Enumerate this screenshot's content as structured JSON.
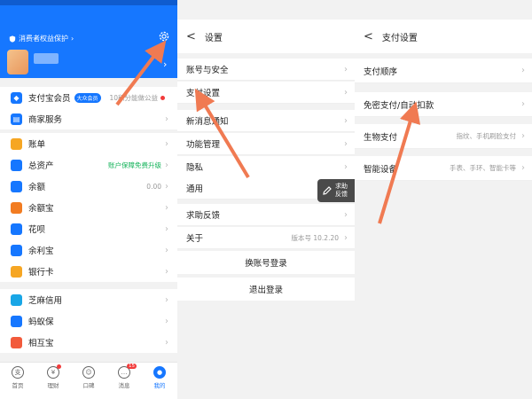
{
  "panel1": {
    "protect_label": "消费者权益保护",
    "member": {
      "label": "支付宝会员",
      "badge": "大众会员",
      "right_text": "10积分能做公益"
    },
    "merchant": {
      "label": "商家服务"
    },
    "menu": [
      {
        "label": "账单",
        "icon": "bill-icon",
        "color": "#f6a623",
        "right": ""
      },
      {
        "label": "总资产",
        "icon": "pie-icon",
        "color": "#1677ff",
        "right": "账户保障免费升级",
        "right_green": true
      },
      {
        "label": "余额",
        "icon": "yen-icon",
        "color": "#1677ff",
        "right": "0.00"
      },
      {
        "label": "余额宝",
        "icon": "yuebao-icon",
        "color": "#f27c21",
        "right": ""
      },
      {
        "label": "花呗",
        "icon": "huabei-icon",
        "color": "#1677ff",
        "right": ""
      },
      {
        "label": "余利宝",
        "icon": "yulibao-icon",
        "color": "#1677ff",
        "right": ""
      },
      {
        "label": "银行卡",
        "icon": "card-icon",
        "color": "#f6a623",
        "right": ""
      },
      {
        "label": "芝麻信用",
        "icon": "sesame-icon",
        "color": "#19a6e6",
        "right": ""
      },
      {
        "label": "蚂蚁保",
        "icon": "antbao-icon",
        "color": "#1677ff",
        "right": ""
      },
      {
        "label": "相互宝",
        "icon": "heart-icon",
        "color": "#f25a3b",
        "right": ""
      }
    ],
    "tabs": [
      {
        "label": "首页",
        "icon": "home-icon"
      },
      {
        "label": "理财",
        "icon": "wealth-icon"
      },
      {
        "label": "口碑",
        "icon": "koubei-icon"
      },
      {
        "label": "消息",
        "icon": "message-icon",
        "count": "15"
      },
      {
        "label": "我的",
        "icon": "user-icon"
      }
    ]
  },
  "panel2": {
    "title": "设置",
    "back": "<",
    "items": [
      {
        "label": "账号与安全",
        "value": ""
      },
      {
        "label": "支付设置",
        "value": ""
      },
      {
        "label": "新消息通知",
        "value": ""
      },
      {
        "label": "功能管理",
        "value": ""
      },
      {
        "label": "隐私",
        "value": ""
      },
      {
        "label": "通用",
        "value": ""
      },
      {
        "label": "求助反馈",
        "value": ""
      },
      {
        "label": "关于",
        "value": "版本号 10.2.20"
      }
    ],
    "switch_account": "换账号登录",
    "logout": "退出登录",
    "float_help": {
      "line1": "求助",
      "line2": "反馈"
    }
  },
  "panel3": {
    "title": "支付设置",
    "back": "<",
    "items": [
      {
        "label": "支付顺序",
        "value": ""
      },
      {
        "label": "免密支付/自动扣款",
        "value": ""
      },
      {
        "label": "生物支付",
        "value": "指纹、手机刷脸支付"
      },
      {
        "label": "智能设备",
        "value": "手表、手环、智能卡等"
      }
    ]
  },
  "colors": {
    "accent": "#1677ff",
    "arrow": "#f07a52"
  }
}
